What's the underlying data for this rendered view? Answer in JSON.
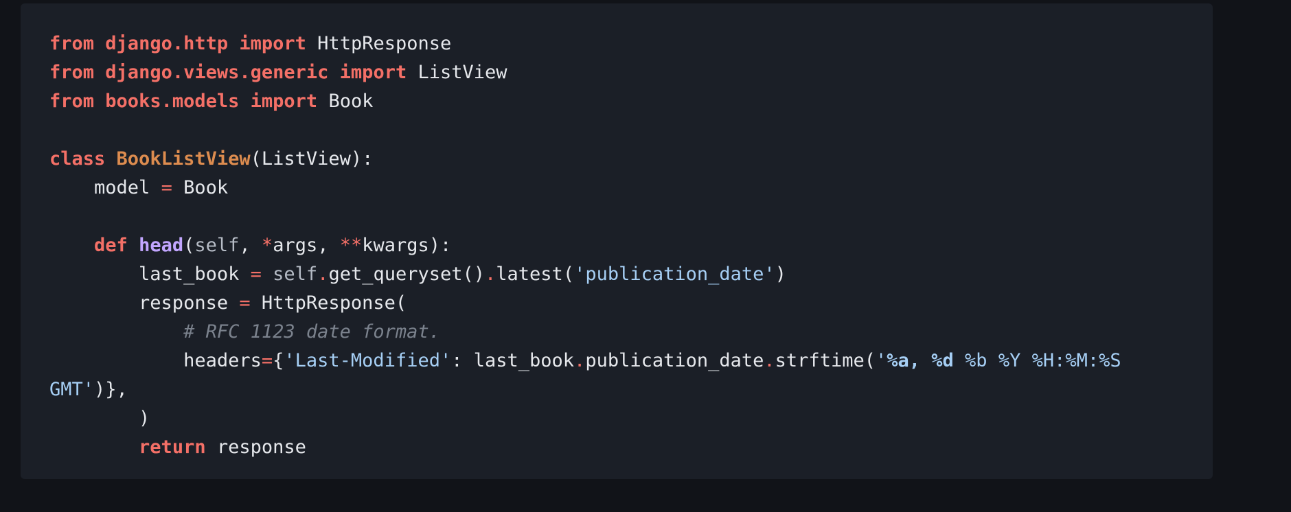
{
  "code_block": {
    "lines": [
      [
        {
          "t": "from",
          "c": "kw"
        },
        {
          "t": " ",
          "c": "plain"
        },
        {
          "t": "django.http",
          "c": "mod"
        },
        {
          "t": " ",
          "c": "plain"
        },
        {
          "t": "import",
          "c": "kw"
        },
        {
          "t": " HttpResponse",
          "c": "plain"
        }
      ],
      [
        {
          "t": "from",
          "c": "kw"
        },
        {
          "t": " ",
          "c": "plain"
        },
        {
          "t": "django.views.generic",
          "c": "mod"
        },
        {
          "t": " ",
          "c": "plain"
        },
        {
          "t": "import",
          "c": "kw"
        },
        {
          "t": " ListView",
          "c": "plain"
        }
      ],
      [
        {
          "t": "from",
          "c": "kw"
        },
        {
          "t": " ",
          "c": "plain"
        },
        {
          "t": "books.models",
          "c": "mod"
        },
        {
          "t": " ",
          "c": "plain"
        },
        {
          "t": "import",
          "c": "kw"
        },
        {
          "t": " Book",
          "c": "plain"
        }
      ],
      [],
      [
        {
          "t": "class",
          "c": "kw"
        },
        {
          "t": " ",
          "c": "plain"
        },
        {
          "t": "BookListView",
          "c": "cls"
        },
        {
          "t": "(ListView):",
          "c": "plain"
        }
      ],
      [
        {
          "t": "    model ",
          "c": "plain"
        },
        {
          "t": "=",
          "c": "op"
        },
        {
          "t": " Book",
          "c": "plain"
        }
      ],
      [],
      [
        {
          "t": "    ",
          "c": "plain"
        },
        {
          "t": "def",
          "c": "kw"
        },
        {
          "t": " ",
          "c": "plain"
        },
        {
          "t": "head",
          "c": "fn"
        },
        {
          "t": "(",
          "c": "plain"
        },
        {
          "t": "self",
          "c": "selfv"
        },
        {
          "t": ", ",
          "c": "plain"
        },
        {
          "t": "*",
          "c": "op"
        },
        {
          "t": "args, ",
          "c": "plain"
        },
        {
          "t": "**",
          "c": "op"
        },
        {
          "t": "kwargs):",
          "c": "plain"
        }
      ],
      [
        {
          "t": "        last_book ",
          "c": "plain"
        },
        {
          "t": "=",
          "c": "op"
        },
        {
          "t": " ",
          "c": "plain"
        },
        {
          "t": "self",
          "c": "selfv"
        },
        {
          "t": ".",
          "c": "op"
        },
        {
          "t": "get_queryset()",
          "c": "plain"
        },
        {
          "t": ".",
          "c": "op"
        },
        {
          "t": "latest(",
          "c": "plain"
        },
        {
          "t": "'publication_date'",
          "c": "str"
        },
        {
          "t": ")",
          "c": "plain"
        }
      ],
      [
        {
          "t": "        response ",
          "c": "plain"
        },
        {
          "t": "=",
          "c": "op"
        },
        {
          "t": " HttpResponse(",
          "c": "plain"
        }
      ],
      [
        {
          "t": "            ",
          "c": "plain"
        },
        {
          "t": "# RFC 1123 date format.",
          "c": "cmt"
        }
      ],
      [
        {
          "t": "            headers",
          "c": "plain"
        },
        {
          "t": "=",
          "c": "op"
        },
        {
          "t": "{",
          "c": "plain"
        },
        {
          "t": "'Last-Modified'",
          "c": "str"
        },
        {
          "t": ": last_book",
          "c": "plain"
        },
        {
          "t": ".",
          "c": "op"
        },
        {
          "t": "publication_date",
          "c": "plain"
        },
        {
          "t": ".",
          "c": "op"
        },
        {
          "t": "strftime(",
          "c": "plain"
        },
        {
          "t": "'",
          "c": "str"
        },
        {
          "t": "%a",
          "c": "fmt"
        },
        {
          "t": ", ",
          "c": "fmt"
        },
        {
          "t": "%d",
          "c": "fmt"
        },
        {
          "t": " %b %Y %H:%M:%S",
          "c": "str"
        }
      ],
      [
        {
          "t": "GMT'",
          "c": "str"
        },
        {
          "t": ")},",
          "c": "plain"
        }
      ],
      [
        {
          "t": "        )",
          "c": "plain"
        }
      ],
      [
        {
          "t": "        ",
          "c": "plain"
        },
        {
          "t": "return",
          "c": "kw"
        },
        {
          "t": " response",
          "c": "plain"
        }
      ]
    ]
  }
}
